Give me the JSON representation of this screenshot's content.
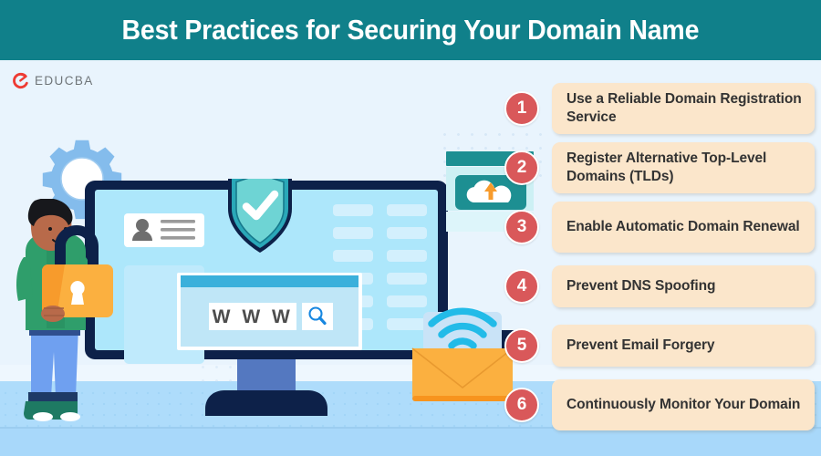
{
  "header": {
    "title": "Best Practices for Securing Your Domain Name",
    "background_color": "#10808a",
    "text_color": "#ffffff"
  },
  "brand": {
    "logo_text": "EDUCBA",
    "logo_mark": "educba-swirl-icon",
    "logo_mark_color": "#ee3b33",
    "logo_text_color": "#6f7579"
  },
  "theme": {
    "page_background": "#e9f4fd",
    "floor_band": "#aedcfb",
    "badge_color": "#d9585a",
    "card_color": "#fbe6cb",
    "card_text_color": "#333333",
    "accent_teal": "#10808a",
    "accent_navy": "#0d2149",
    "accent_orange": "#fbb040"
  },
  "illustration": {
    "gear": "gear-icon",
    "person": "person-holding-padlock-illustration",
    "padlock": "padlock-icon",
    "monitor": "desktop-monitor-illustration",
    "shield": "shield-check-icon",
    "user_card": "user-profile-card-icon",
    "browser_www_text": "W W W",
    "search": "magnifier-icon",
    "cloud_upload": "cloud-upload-icon",
    "envelope": "envelope-icon",
    "wifi": "wifi-icon"
  },
  "items": [
    {
      "number": "1",
      "label": "Use a Reliable Domain Registration Service",
      "lines": 2
    },
    {
      "number": "2",
      "label": "Register Alternative Top-Level Domains (TLDs)",
      "lines": 2
    },
    {
      "number": "3",
      "label": "Enable Automatic Domain Renewal",
      "lines": 2
    },
    {
      "number": "4",
      "label": "Prevent DNS Spoofing",
      "lines": 1
    },
    {
      "number": "5",
      "label": "Prevent Email Forgery",
      "lines": 1
    },
    {
      "number": "6",
      "label": "Continuously Monitor Your Domain",
      "lines": 2
    }
  ]
}
